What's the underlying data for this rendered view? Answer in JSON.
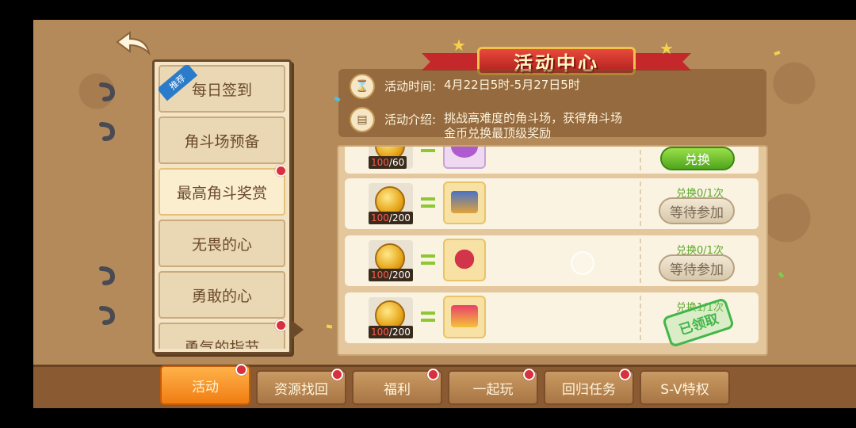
{
  "header": {
    "title": "活动中心"
  },
  "menu": {
    "recommend_tag": "推荐",
    "items": [
      {
        "label": "每日签到"
      },
      {
        "label": "角斗场预备"
      },
      {
        "label": "最高角斗奖赏"
      },
      {
        "label": "无畏的心"
      },
      {
        "label": "勇敢的心"
      },
      {
        "label": "勇气的指节"
      }
    ]
  },
  "info": {
    "time_label": "活动时间:",
    "time_value": "4月22日5时-5月27日5时",
    "desc_label": "活动介绍:",
    "desc_value": "挑战高难度的角斗场，获得角斗场金币兑换最顶级奖励"
  },
  "rewards": [
    {
      "have": "100",
      "need": "/60",
      "button": "兑换"
    },
    {
      "have": "100",
      "need": "/200",
      "limit": "兑换0/1次",
      "button": "等待参加"
    },
    {
      "have": "100",
      "need": "/200",
      "limit": "兑换0/1次",
      "button": "等待参加"
    },
    {
      "have": "100",
      "need": "/200",
      "limit": "兑换1/1次",
      "stamp": "已领取"
    }
  ],
  "tabs": [
    {
      "label": "活动"
    },
    {
      "label": "资源找回"
    },
    {
      "label": "福利"
    },
    {
      "label": "一起玩"
    },
    {
      "label": "回归任务"
    },
    {
      "label": "S-V特权"
    }
  ],
  "colors": {
    "accent": "#f07d12",
    "badge": "#d9313b",
    "confirm": "#4fa51c",
    "background": "#b58a5a"
  }
}
